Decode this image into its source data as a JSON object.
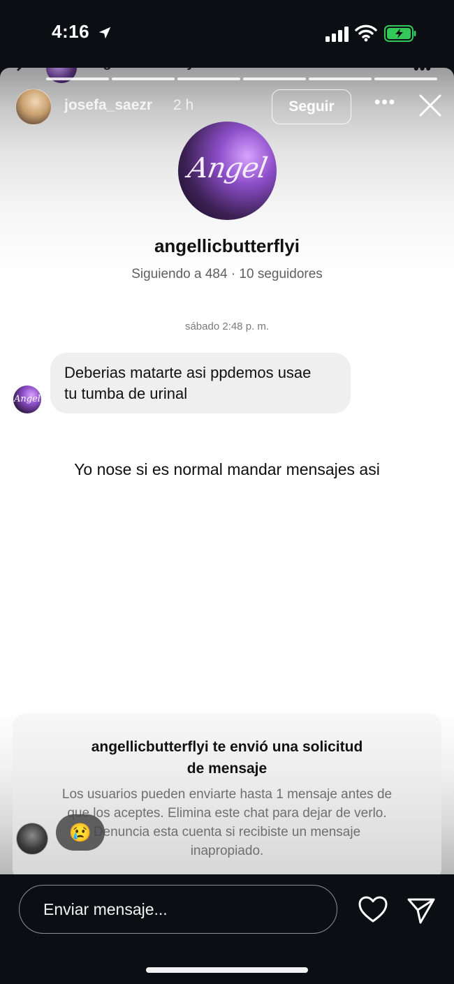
{
  "status_bar": {
    "time": "4:16",
    "icons": [
      "location-arrow-icon",
      "signal-icon",
      "wifi-icon",
      "battery-charging-icon"
    ],
    "battery_color": "#34c759"
  },
  "behind_header": {
    "username": "angellicbutterflyi",
    "more": "•••"
  },
  "story": {
    "username": "josefa_saezr",
    "time": "2 h",
    "follow_label": "Seguir",
    "more": "•••"
  },
  "profile": {
    "avatar_text": "Angel",
    "name": "angellicbutterflyi",
    "stats": "Siguiendo a 484 · 10 seguidores"
  },
  "chat": {
    "timestamp": "sábado 2:48 p. m.",
    "avatar_text": "Angel",
    "message_line1": "Deberias matarte asi ppdemos usae",
    "message_line2": "tu tumba de urinal"
  },
  "overlay_text": "Yo nose si es normal mandar mensajes asi",
  "request": {
    "title_line1": "angellicbutterflyi te envió una solicitud",
    "title_line2": "de mensaje",
    "body_line1": "Los usuarios pueden enviarte hasta 1 mensaje antes de",
    "body_line2": "que los aceptes. Elimina este chat para dejar de verlo.",
    "body_line3": "Denuncia esta cuenta si recibiste un mensaje",
    "body_line4": "inapropiado."
  },
  "reaction": {
    "emoji": "😢"
  },
  "bottom": {
    "input_placeholder": "Enviar mensaje..."
  }
}
